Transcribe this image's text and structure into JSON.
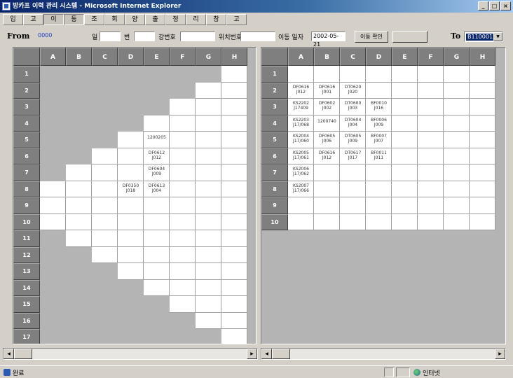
{
  "window": {
    "title": "방카프 이력 관리 시스템 - Microsoft Internet Explorer"
  },
  "menu": [
    "입",
    "고",
    "이",
    "동",
    "조",
    "회",
    "양",
    "출",
    "정",
    "리",
    "창",
    "고"
  ],
  "menu_active": [
    2,
    3
  ],
  "toolbar": {
    "from_label": "From",
    "from_value": "0000",
    "field1_label": "일",
    "field2_label": "번",
    "field3_label": "강번호",
    "field4_label": "위치번호",
    "date_label": "이동 일자",
    "date_value": "2002-05-21",
    "confirm_button": "이동 확인",
    "disabled_button": "",
    "to_label": "To",
    "to_value": "B1100015"
  },
  "columns": [
    "A",
    "B",
    "C",
    "D",
    "E",
    "F",
    "G",
    "H"
  ],
  "left_rows": [
    "1",
    "2",
    "3",
    "4",
    "5",
    "6",
    "7",
    "8",
    "9",
    "10",
    "11",
    "12",
    "13",
    "14",
    "15",
    "16",
    "17"
  ],
  "right_rows": [
    "1",
    "2",
    "3",
    "4",
    "5",
    "6",
    "7",
    "8",
    "9",
    "10"
  ],
  "left_cells": {
    "5E": [
      "1200205"
    ],
    "6E": [
      "DF0612",
      "J012"
    ],
    "7E": [
      "DF0604",
      "J009"
    ],
    "8D": [
      "DF0350",
      "J018"
    ],
    "8E": [
      "DF0613",
      "J004"
    ]
  },
  "right_cells": {
    "2A": [
      "DF0616",
      "J012"
    ],
    "2B": [
      "DF0616",
      "J001"
    ],
    "2C": [
      "DT0620",
      "J020"
    ],
    "3A": [
      "KS2202",
      "J17409"
    ],
    "3B": [
      "DF0602",
      "J002"
    ],
    "3C": [
      "DT0600",
      "J003"
    ],
    "3D": [
      "BF0010",
      "J016"
    ],
    "4A": [
      "KS2203",
      "J17/068"
    ],
    "4B": [
      "1200740"
    ],
    "4C": [
      "DT0604",
      "J004"
    ],
    "4D": [
      "BF0006",
      "J009"
    ],
    "5A": [
      "KS2004",
      "J17/060"
    ],
    "5B": [
      "DF0605",
      "J006"
    ],
    "5C": [
      "DT0605",
      "J009"
    ],
    "5D": [
      "BF0007",
      "J007"
    ],
    "6A": [
      "KS2005",
      "J17/061"
    ],
    "6B": [
      "DF0616",
      "J012"
    ],
    "6C": [
      "DT0617",
      "J017"
    ],
    "6D": [
      "BF0011",
      "J011"
    ],
    "7A": [
      "KS2006",
      "J17/062"
    ],
    "8A": [
      "KS2007",
      "J17/066"
    ]
  },
  "status": {
    "text": "완료",
    "zone": "인터넷"
  }
}
